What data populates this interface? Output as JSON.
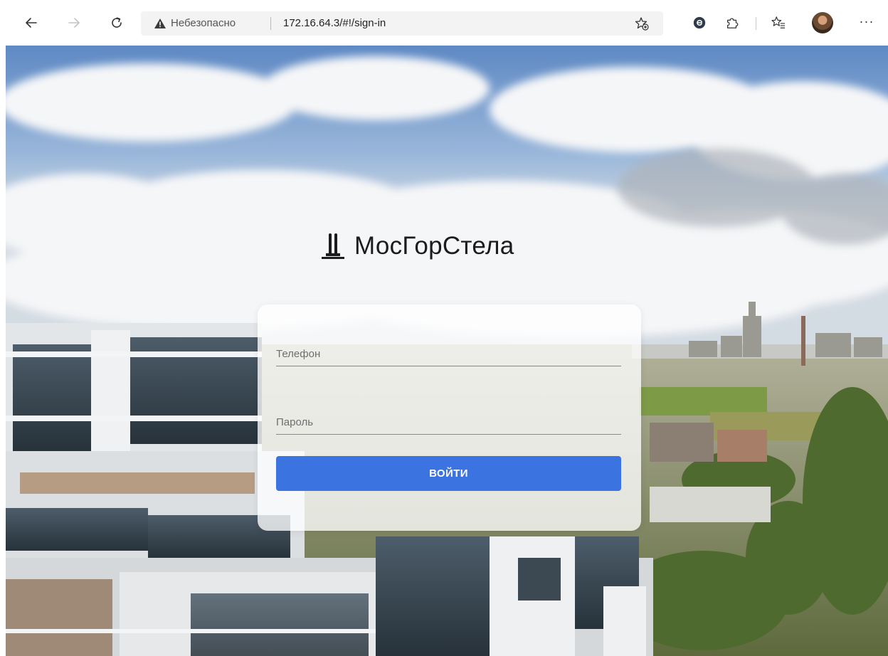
{
  "browser": {
    "security_label": "Небезопасно",
    "url": "172.16.64.3/#!/sign-in"
  },
  "icons": {
    "back": "arrow-left-icon",
    "forward": "arrow-right-icon",
    "reload": "reload-icon",
    "warning": "warning-triangle-icon",
    "add_favorite": "star-plus-icon",
    "extension_1": "extension-e-icon",
    "extensions": "puzzle-icon",
    "favorites": "favorites-list-icon",
    "more": "more-dots-icon"
  },
  "brand": {
    "name": "МосГорСтела"
  },
  "login_form": {
    "phone_placeholder": "Телефон",
    "phone_value": "",
    "password_placeholder": "Пароль",
    "password_value": "",
    "submit_label": "ВОЙТИ"
  },
  "colors": {
    "accent": "#3b73e0",
    "card_background": "rgba(255,255,255,0.78)",
    "brand_text": "#1c1c1c"
  }
}
